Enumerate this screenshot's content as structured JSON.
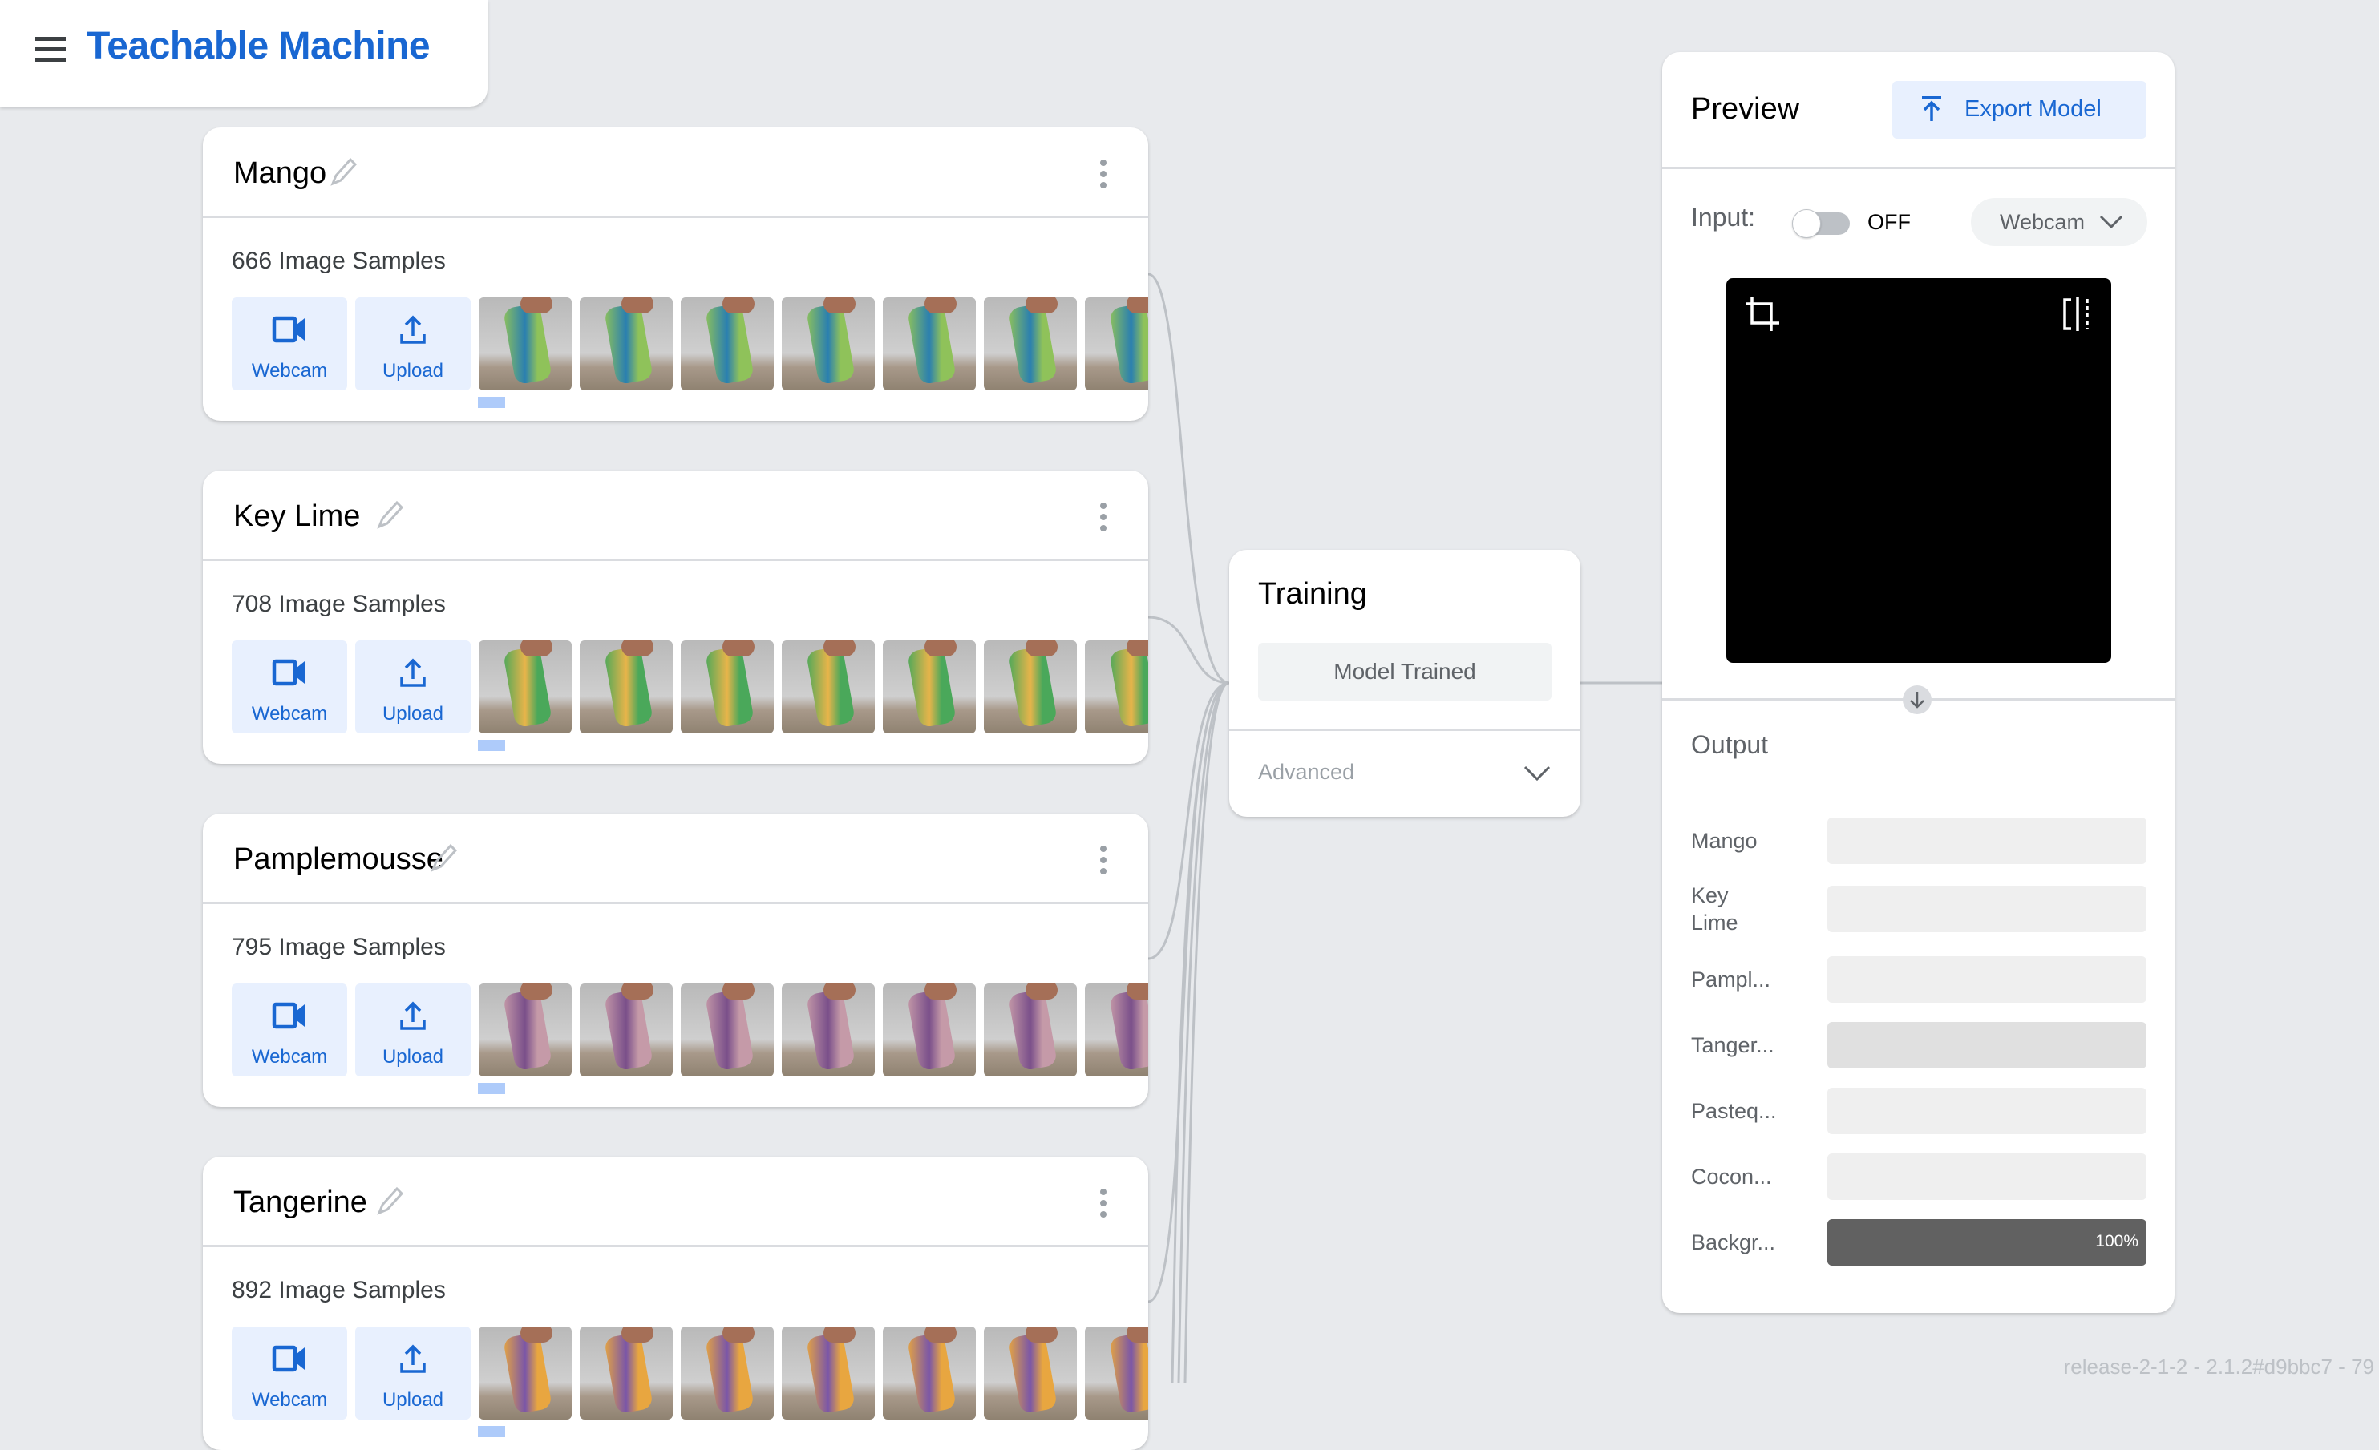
{
  "app": {
    "title": "Teachable Machine",
    "menu_icon": "hamburger-menu-icon"
  },
  "classes": [
    {
      "name": "Mango",
      "samples": "666 Image Samples",
      "webcam_label": "Webcam",
      "upload_label": "Upload",
      "can_color": "#8fc25a",
      "can_accent": "#2a7fb0"
    },
    {
      "name": "Key Lime",
      "samples": "708 Image Samples",
      "webcam_label": "Webcam",
      "upload_label": "Upload",
      "can_color": "#4aa85a",
      "can_accent": "#e8b44a"
    },
    {
      "name": "Pamplemousse",
      "samples": "795 Image Samples",
      "webcam_label": "Webcam",
      "upload_label": "Upload",
      "can_color": "#c59aa8",
      "can_accent": "#7a4f8a"
    },
    {
      "name": "Tangerine",
      "samples": "892 Image Samples",
      "webcam_label": "Webcam",
      "upload_label": "Upload",
      "can_color": "#e8a640",
      "can_accent": "#7a56a8"
    }
  ],
  "training": {
    "title": "Training",
    "status": "Model Trained",
    "advanced_label": "Advanced"
  },
  "preview": {
    "title": "Preview",
    "export_label": "Export Model",
    "input_label": "Input:",
    "toggle_state": "OFF",
    "input_source": "Webcam",
    "output_title": "Output",
    "outputs": [
      {
        "label": "Mango",
        "value": 0,
        "display": ""
      },
      {
        "label": "Key Lime",
        "value": 0,
        "display": ""
      },
      {
        "label": "Pampl...",
        "value": 0,
        "display": ""
      },
      {
        "label": "Tanger...",
        "value": 0,
        "display": ""
      },
      {
        "label": "Pasteq...",
        "value": 0,
        "display": ""
      },
      {
        "label": "Cocon...",
        "value": 0,
        "display": ""
      },
      {
        "label": "Backgr...",
        "value": 1.0,
        "display": "100%"
      }
    ]
  },
  "colors": {
    "brand": "#1967d2",
    "button_bg": "#e8f0fe",
    "output_fill": "#616161",
    "background": "#e8eaed"
  },
  "version": "release-2-1-2 - 2.1.2#d9bbc7 - 79"
}
